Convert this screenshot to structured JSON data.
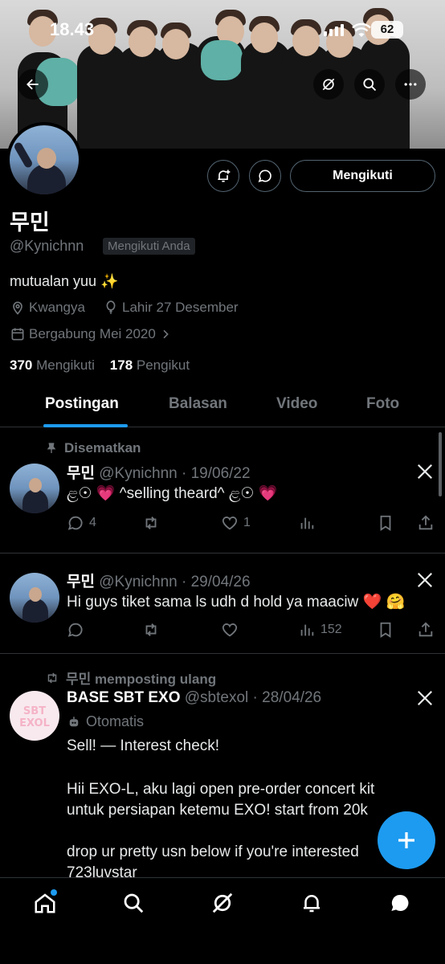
{
  "status_bar": {
    "time": "18.43",
    "battery": "62"
  },
  "profile": {
    "display_name": "무민",
    "handle": "@Kynichnn",
    "follows_you": "Mengikuti Anda",
    "follow_button": "Mengikuti",
    "bio": "mutualan yuu ✨",
    "location": "Kwangya",
    "birthday": "Lahir 27 Desember",
    "joined": "Bergabung Mei 2020",
    "following_count": "370",
    "following_label": "Mengikuti",
    "followers_count": "178",
    "followers_label": "Pengikut"
  },
  "tabs": [
    "Postingan",
    "Balasan",
    "Video",
    "Foto"
  ],
  "posts": [
    {
      "pinned_label": "Disematkan",
      "name": "무민",
      "handle": "@Kynichnn",
      "date": "· 19/06/22",
      "text": "ළ☉ 💗 ^selling theard^ ළ☉ 💗",
      "replies": "4",
      "reposts": "",
      "likes": "1",
      "views": ""
    },
    {
      "name": "무민",
      "handle": "@Kynichnn",
      "date": "· 29/04/26",
      "text": "Hi guys tiket sama ls udh d hold ya maaciw ❤️ 🤗",
      "replies": "",
      "reposts": "",
      "likes": "",
      "views": "152"
    },
    {
      "repost_label": "무민 memposting ulang",
      "name": "BASE SBT EXO",
      "handle": "@sbtexol",
      "date": "· 28/04/26",
      "automated": "Otomatis",
      "avatar_text": "SBT EXOL",
      "lines": [
        "Sell! — Interest check!",
        "Hii EXO-L, aku lagi open pre-order concert kit",
        "untuk persiapan ketemu EXO! start from 20k",
        "drop ur pretty usn below if you're interested",
        "723luvstar"
      ]
    }
  ],
  "colors": {
    "accent": "#1d9bf0",
    "background": "#000000",
    "muted": "#71767b"
  }
}
